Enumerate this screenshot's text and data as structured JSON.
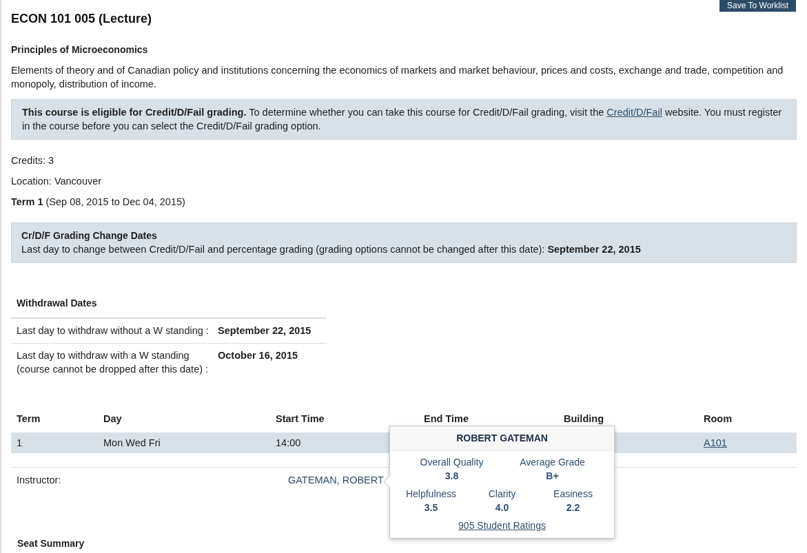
{
  "header": {
    "title": "ECON 101 005 (Lecture)",
    "save_button": "Save To Worklist"
  },
  "course": {
    "name": "Principles of Microeconomics",
    "description": "Elements of theory and of Canadian policy and institutions concerning the economics of markets and market behaviour, prices and costs, exchange and trade, competition and monopoly, distribution of income."
  },
  "credit_notice": {
    "text": "**This course is eligible for Credit/D/Fail grading.** To determine whether you can take this course for Credit/D/Fail grading, visit the",
    "link": "Credit/D/Fail",
    "text_after": "website. You must register in the course before you can select the Credit/D/Fail grading option."
  },
  "details": [
    "Credits: 3",
    "Location: Vancouver",
    "**Term 1** (Sep 08, 2015 to Dec 04, 2015)"
  ],
  "grading_dates": {
    "title": "Cr/D/F Grading Change Dates",
    "text": "Last day to change between Credit/D/Fail and percentage grading (grading options cannot be changed after this date): **September 22, 2015**"
  },
  "withdrawal": {
    "title": "Withdrawal Dates",
    "rows": [
      {
        "label": "Last day to withdraw without a W standing :",
        "date": "September 22, 2015"
      },
      {
        "label": "Last day to withdraw with a W standing (course cannot be dropped after this date) :",
        "date": "October 16, 2015"
      }
    ]
  },
  "schedule": {
    "columns": [
      "Term",
      "Day",
      "Start Time",
      "End Time",
      "Building",
      "Room"
    ],
    "rows": [
      {
        "term": "1",
        "day": "Mon Wed Fri",
        "start_time": "14:00",
        "room": "A101"
      }
    ]
  },
  "instructor": {
    "label": "Instructor:",
    "name": "GATEMAN, ROBERT"
  },
  "popover": {
    "name": "ROBERT GATEMAN",
    "metric_rows": [
      [
        {
          "label": "Overall Quality",
          "value": "3.8"
        },
        {
          "label": "Average Grade",
          "value": "B+"
        }
      ],
      [
        {
          "label": "Helpfulness",
          "value": "3.5"
        },
        {
          "label": "Clarity",
          "value": "4.0"
        },
        {
          "label": "Easiness",
          "value": "2.2"
        }
      ]
    ],
    "link": "905 Student Ratings"
  },
  "seat_summary": {
    "title": "Seat Summary"
  }
}
